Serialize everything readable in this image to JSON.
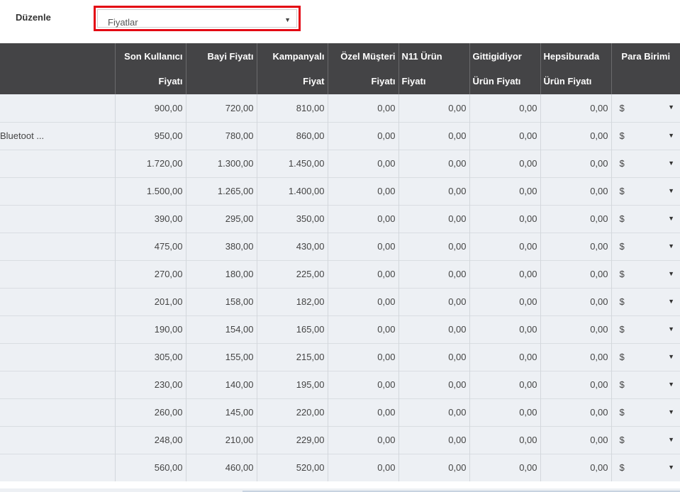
{
  "toolbar": {
    "edit_label": "Düzenle",
    "select_value": "Fiyatlar"
  },
  "columns": [
    {
      "line1": "",
      "line2": ""
    },
    {
      "line1": "Son Kullanıcı",
      "line2": "Fiyatı"
    },
    {
      "line1": "Bayi Fiyatı",
      "line2": ""
    },
    {
      "line1": "Kampanyalı",
      "line2": "Fiyat"
    },
    {
      "line1": "Özel Müşteri",
      "line2": "Fiyatı"
    },
    {
      "line1": "N11 Ürün",
      "line2": "Fiyatı"
    },
    {
      "line1": "Gittigidiyor",
      "line2": "Ürün Fiyatı"
    },
    {
      "line1": "Hepsiburada",
      "line2": "Ürün Fiyatı"
    },
    {
      "line1": "Para Birimi",
      "line2": ""
    }
  ],
  "rows": [
    {
      "name": "",
      "values": [
        "900,00",
        "720,00",
        "810,00",
        "0,00",
        "0,00",
        "0,00",
        "0,00"
      ],
      "currency": "$"
    },
    {
      "name": "Bluetoot ...",
      "values": [
        "950,00",
        "780,00",
        "860,00",
        "0,00",
        "0,00",
        "0,00",
        "0,00"
      ],
      "currency": "$"
    },
    {
      "name": "",
      "values": [
        "1.720,00",
        "1.300,00",
        "1.450,00",
        "0,00",
        "0,00",
        "0,00",
        "0,00"
      ],
      "currency": "$"
    },
    {
      "name": "",
      "values": [
        "1.500,00",
        "1.265,00",
        "1.400,00",
        "0,00",
        "0,00",
        "0,00",
        "0,00"
      ],
      "currency": "$"
    },
    {
      "name": "",
      "values": [
        "390,00",
        "295,00",
        "350,00",
        "0,00",
        "0,00",
        "0,00",
        "0,00"
      ],
      "currency": "$"
    },
    {
      "name": "",
      "values": [
        "475,00",
        "380,00",
        "430,00",
        "0,00",
        "0,00",
        "0,00",
        "0,00"
      ],
      "currency": "$"
    },
    {
      "name": "",
      "values": [
        "270,00",
        "180,00",
        "225,00",
        "0,00",
        "0,00",
        "0,00",
        "0,00"
      ],
      "currency": "$"
    },
    {
      "name": "",
      "values": [
        "201,00",
        "158,00",
        "182,00",
        "0,00",
        "0,00",
        "0,00",
        "0,00"
      ],
      "currency": "$"
    },
    {
      "name": "",
      "values": [
        "190,00",
        "154,00",
        "165,00",
        "0,00",
        "0,00",
        "0,00",
        "0,00"
      ],
      "currency": "$"
    },
    {
      "name": "",
      "values": [
        "305,00",
        "155,00",
        "215,00",
        "0,00",
        "0,00",
        "0,00",
        "0,00"
      ],
      "currency": "$"
    },
    {
      "name": "",
      "values": [
        "230,00",
        "140,00",
        "195,00",
        "0,00",
        "0,00",
        "0,00",
        "0,00"
      ],
      "currency": "$"
    },
    {
      "name": "",
      "values": [
        "260,00",
        "145,00",
        "220,00",
        "0,00",
        "0,00",
        "0,00",
        "0,00"
      ],
      "currency": "$"
    },
    {
      "name": "",
      "values": [
        "248,00",
        "210,00",
        "229,00",
        "0,00",
        "0,00",
        "0,00",
        "0,00"
      ],
      "currency": "$"
    },
    {
      "name": "",
      "values": [
        "560,00",
        "460,00",
        "520,00",
        "0,00",
        "0,00",
        "0,00",
        "0,00"
      ],
      "currency": "$"
    }
  ],
  "icons": {
    "dropdown_arrow": "chevron-down-icon"
  },
  "colors": {
    "header_bg": "#444446",
    "row_bg": "#edf0f4",
    "highlight_border": "#e30613"
  }
}
